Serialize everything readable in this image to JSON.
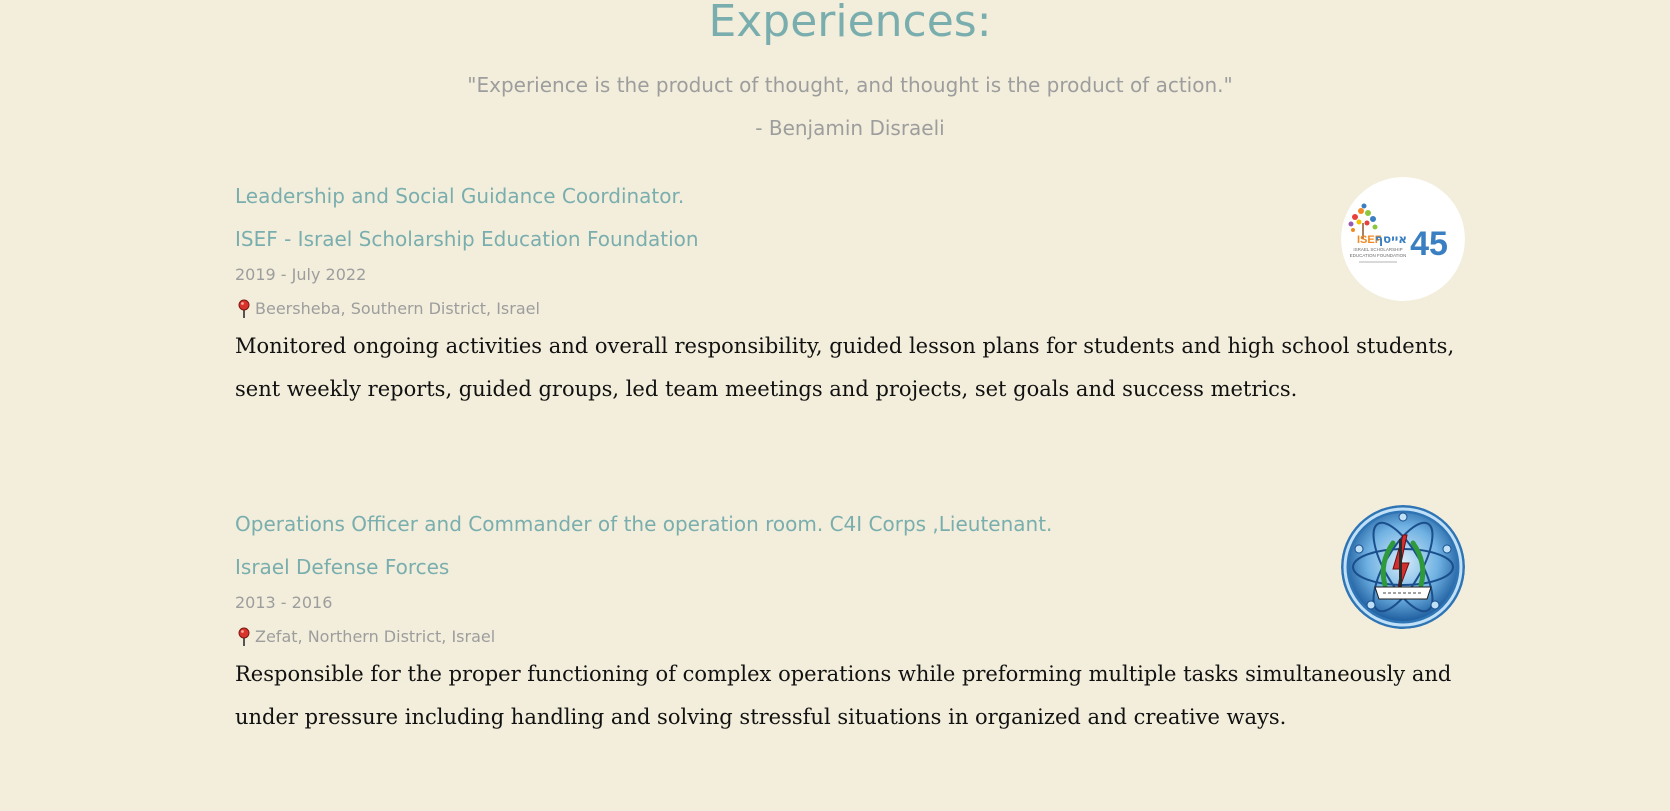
{
  "section": {
    "title": "Experiences:",
    "quote": "\"Experience is the product of thought, and thought is the product of action.\"",
    "quote_author": "- Benjamin Disraeli"
  },
  "experiences": [
    {
      "role": "Leadership and Social Guidance Coordinator.",
      "company": "ISEF - Israel Scholarship Education Foundation",
      "dates": "2019 - July 2022",
      "location": "Beersheba, Southern District, Israel",
      "description": "Monitored ongoing activities and overall responsibility, guided lesson plans for students and high school students, sent weekly reports, guided groups, led team meetings and projects, set goals and success metrics.",
      "logo": {
        "icon": "isef-logo",
        "brand_text": "ISEF",
        "hebrew_text": "אייסף",
        "number": "45",
        "caption_1": "ISRAEL SCHOLARSHIP",
        "caption_2": "EDUCATION FOUNDATION",
        "colors": [
          "#f08a24",
          "#3a7fc1",
          "#8cc63f",
          "#e8413c"
        ]
      }
    },
    {
      "role": "Operations Officer and Commander of the operation room. C4I Corps ,Lieutenant.",
      "company": "Israel Defense Forces",
      "dates": "2013 - 2016",
      "location": "Zefat, Northern District, Israel",
      "description": "Responsible for the proper functioning of complex operations while preforming multiple tasks simultaneously and under pressure including handling and solving stressful situations in organized and creative ways.",
      "logo": {
        "icon": "c4i-corps-emblem",
        "colors": [
          "#3f8fd0",
          "#1f5fa0",
          "#2e9a3c",
          "#d32f2f"
        ]
      }
    }
  ],
  "icons": {
    "location": "map-pin-icon"
  },
  "colors": {
    "background": "#f2eedb",
    "accent": "#7aaeae",
    "muted": "#9d9d9d",
    "body_text": "#111111"
  }
}
